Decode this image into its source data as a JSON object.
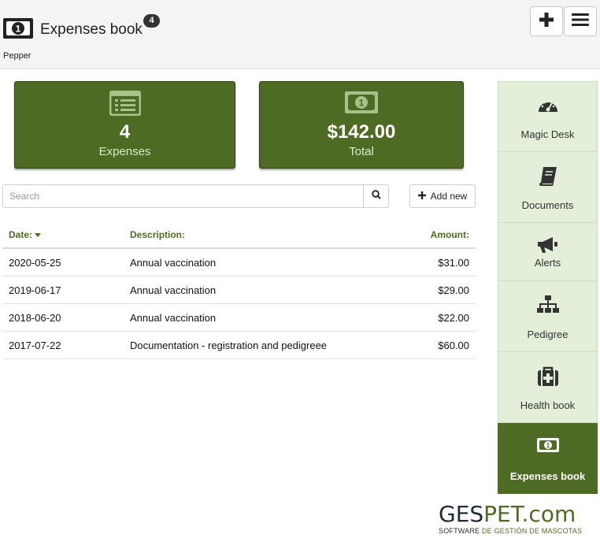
{
  "header": {
    "title": "Expenses book",
    "badge": "4",
    "subtitle": "Pepper",
    "add_icon": "plus-icon",
    "menu_icon": "hamburger-menu-icon",
    "title_icon": "banknote-icon"
  },
  "stats": {
    "expenses": {
      "value": "4",
      "label": "Expenses",
      "icon": "list-icon"
    },
    "total": {
      "value": "$142.00",
      "label": "Total",
      "icon": "banknote-icon"
    }
  },
  "toolbar": {
    "search_placeholder": "Search",
    "search_icon": "search-icon",
    "add_new_label": "Add new",
    "add_new_icon": "plus-icon"
  },
  "table": {
    "columns": [
      "Date:",
      "Description:",
      "Amount:"
    ],
    "sorted_column": "Date:",
    "rows": [
      {
        "date": "2020-05-25",
        "description": "Annual vaccination",
        "amount": "$31.00"
      },
      {
        "date": "2019-06-17",
        "description": "Annual vaccination",
        "amount": "$29.00"
      },
      {
        "date": "2018-06-20",
        "description": "Annual vaccination",
        "amount": "$22.00"
      },
      {
        "date": "2017-07-22",
        "description": "Documentation - registration and pedigreee",
        "amount": "$60.00"
      }
    ]
  },
  "sidebar": {
    "items": [
      {
        "label": "Magic Desk",
        "icon": "gauge-icon",
        "active": false
      },
      {
        "label": "Documents",
        "icon": "book-icon",
        "active": false
      },
      {
        "label": "Alerts",
        "icon": "megaphone-icon",
        "active": false
      },
      {
        "label": "Pedigree",
        "icon": "sitemap-icon",
        "active": false
      },
      {
        "label": "Health book",
        "icon": "medkit-icon",
        "active": false
      },
      {
        "label": "Expenses book",
        "icon": "banknote-icon",
        "active": true
      }
    ]
  },
  "logo": {
    "brand_part1": "GES",
    "brand_part2": "PET.com",
    "tagline_part1": "SOFTWARE ",
    "tagline_part2": "DE GESTIÓN DE MASCOTAS"
  },
  "colors": {
    "accent": "#4e6b24",
    "sidebar_bg": "#e3efd9",
    "header_bg": "#f4f4f4"
  }
}
